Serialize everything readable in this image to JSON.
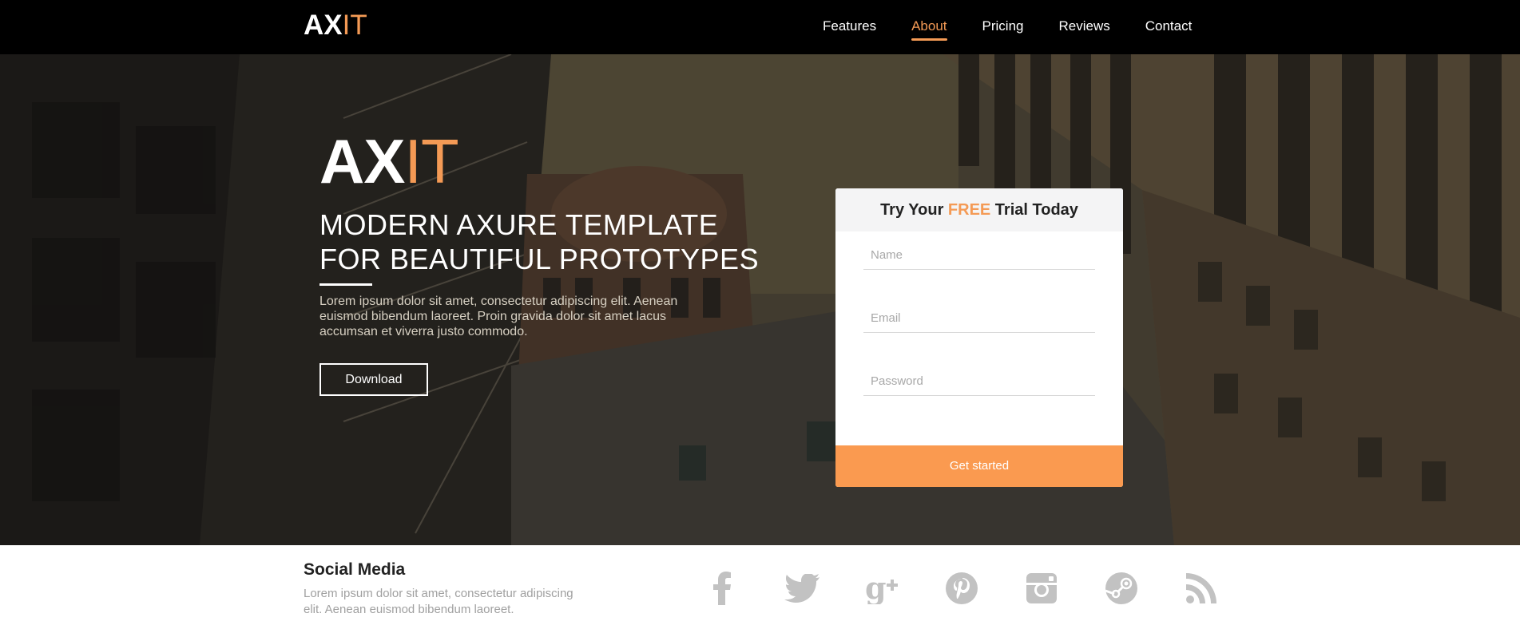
{
  "nav": {
    "brand_main": "AX",
    "brand_accent": "IT",
    "links": [
      {
        "label": "Features"
      },
      {
        "label": "About"
      },
      {
        "label": "Pricing"
      },
      {
        "label": "Reviews"
      },
      {
        "label": "Contact"
      }
    ],
    "active_link": "About"
  },
  "hero": {
    "logo_main": "AX",
    "logo_accent": "IT",
    "title_line1": "MODERN AXURE TEMPLATE",
    "title_line2": "FOR BEAUTIFUL PROTOTYPES",
    "description": "Lorem ipsum dolor sit amet, consectetur adipiscing elit. Aenean euismod bibendum laoreet. Proin gravida dolor sit amet lacus accumsan et viverra justo commodo.",
    "download_label": "Download"
  },
  "signup": {
    "title_before": "Try Your ",
    "title_highlight": "FREE",
    "title_after": " Trial Today",
    "name_placeholder": "Name",
    "email_placeholder": "Email",
    "password_placeholder": "Password",
    "submit_label": "Get started"
  },
  "footer": {
    "title": "Social Media",
    "text": "Lorem ipsum dolor sit amet, consectetur adipiscing elit. Aenean euismod bibendum laoreet.",
    "icons": [
      "facebook-icon",
      "twitter-icon",
      "google-plus-icon",
      "pinterest-icon",
      "instagram-icon",
      "steam-icon",
      "rss-icon"
    ]
  },
  "colors": {
    "accent": "#f49a55",
    "cta": "#fa9a50",
    "nav_bg": "#000000",
    "icon_gray": "#bdbdbd"
  }
}
